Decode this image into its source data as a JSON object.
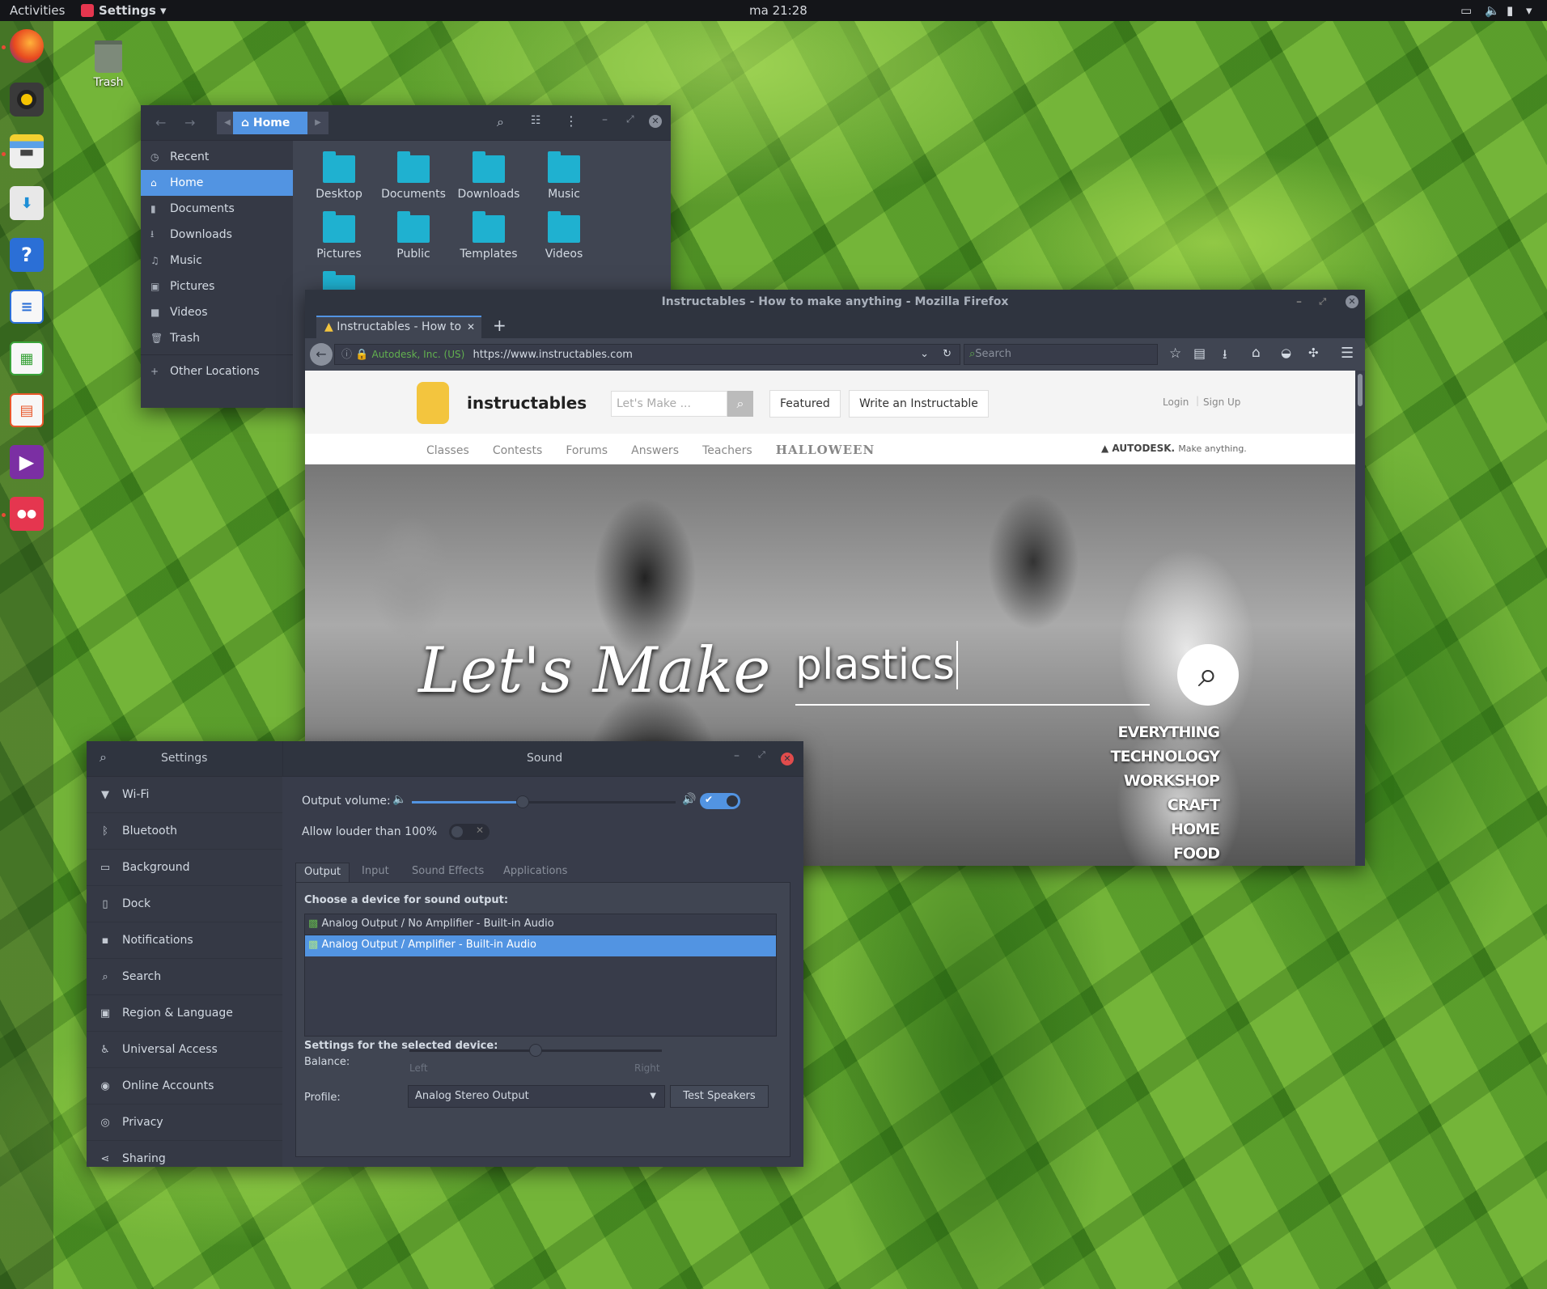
{
  "topbar": {
    "activities": "Activities",
    "app_menu": "Settings",
    "clock": "ma 21:28"
  },
  "desktop": {
    "trash_label": "Trash"
  },
  "dock": {
    "items": [
      "firefox-icon",
      "rhythmbox-icon",
      "files-icon",
      "software-icon",
      "help-icon",
      "writer-icon",
      "calc-icon",
      "impress-icon",
      "videos-icon",
      "settings-icon"
    ]
  },
  "files": {
    "location": "Home",
    "sidebar": [
      "Recent",
      "Home",
      "Documents",
      "Downloads",
      "Music",
      "Pictures",
      "Videos",
      "Trash"
    ],
    "other": "Other Locations",
    "folders": [
      "Desktop",
      "Documents",
      "Downloads",
      "Music",
      "Pictures",
      "Public",
      "Templates",
      "Videos"
    ]
  },
  "firefox": {
    "title": "Instructables - How to make anything - Mozilla Firefox",
    "tab": "Instructables - How to",
    "identity": "Autodesk, Inc. (US)",
    "url": "https://www.instructables.com",
    "search_placeholder": "Search",
    "site": {
      "brand": "instructables",
      "search_placeholder": "Let's Make ...",
      "featured": "Featured",
      "write": "Write an Instructable",
      "login": "Login",
      "signup": "Sign Up",
      "nav": [
        "Classes",
        "Contests",
        "Forums",
        "Answers",
        "Teachers"
      ],
      "halloween": "HALLOWEEN",
      "autodesk": "AUTODESK.",
      "autodesk_tag": "Make anything.",
      "hero_text": "Let's Make",
      "hero_query": "plastics",
      "categories": [
        "EVERYTHING",
        "TECHNOLOGY",
        "WORKSHOP",
        "CRAFT",
        "HOME",
        "FOOD"
      ]
    }
  },
  "settings": {
    "left_title": "Settings",
    "right_title": "Sound",
    "sidebar": [
      "Wi-Fi",
      "Bluetooth",
      "Background",
      "Dock",
      "Notifications",
      "Search",
      "Region & Language",
      "Universal Access",
      "Online Accounts",
      "Privacy",
      "Sharing"
    ],
    "output_volume": "Output volume:",
    "louder": "Allow louder than 100%",
    "volume_level": 0.42,
    "tabs": [
      "Output",
      "Input",
      "Sound Effects",
      "Applications"
    ],
    "choose": "Choose a device for sound output:",
    "devices": [
      "Analog Output / No Amplifier - Built-in Audio",
      "Analog Output / Amplifier - Built-in Audio"
    ],
    "selected_heading": "Settings for the selected device:",
    "balance": "Balance:",
    "left": "Left",
    "right": "Right",
    "balance_level": 0.5,
    "profile": "Profile:",
    "profile_value": "Analog Stereo Output",
    "test": "Test Speakers"
  }
}
